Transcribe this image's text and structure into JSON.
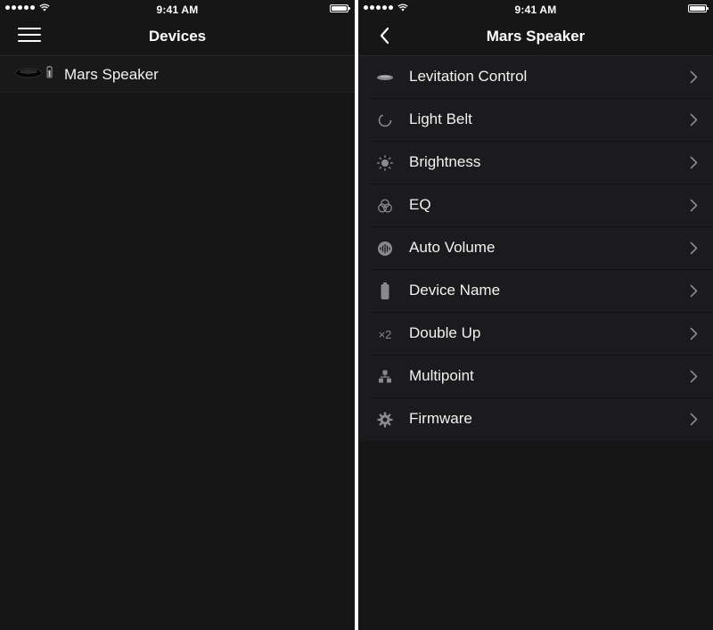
{
  "status_bar": {
    "time": "9:41 AM"
  },
  "left_screen": {
    "title": "Devices",
    "devices": [
      {
        "label": "Mars Speaker"
      }
    ]
  },
  "right_screen": {
    "title": "Mars Speaker",
    "menu_items": [
      {
        "label": "Levitation Control",
        "icon": "levitation-icon"
      },
      {
        "label": "Light Belt",
        "icon": "light-belt-icon"
      },
      {
        "label": "Brightness",
        "icon": "brightness-icon"
      },
      {
        "label": "EQ",
        "icon": "eq-icon"
      },
      {
        "label": "Auto Volume",
        "icon": "auto-volume-icon"
      },
      {
        "label": "Device Name",
        "icon": "device-name-icon"
      },
      {
        "label": "Double Up",
        "icon": "double-up-icon",
        "icon_text": "×2"
      },
      {
        "label": "Multipoint",
        "icon": "multipoint-icon"
      },
      {
        "label": "Firmware",
        "icon": "firmware-icon"
      }
    ]
  },
  "colors": {
    "background": "#161617",
    "list_background": "#1b1b1d",
    "text": "#f2f2f2",
    "icon": "#8a8a8c",
    "chevron": "#8a8a8c"
  }
}
